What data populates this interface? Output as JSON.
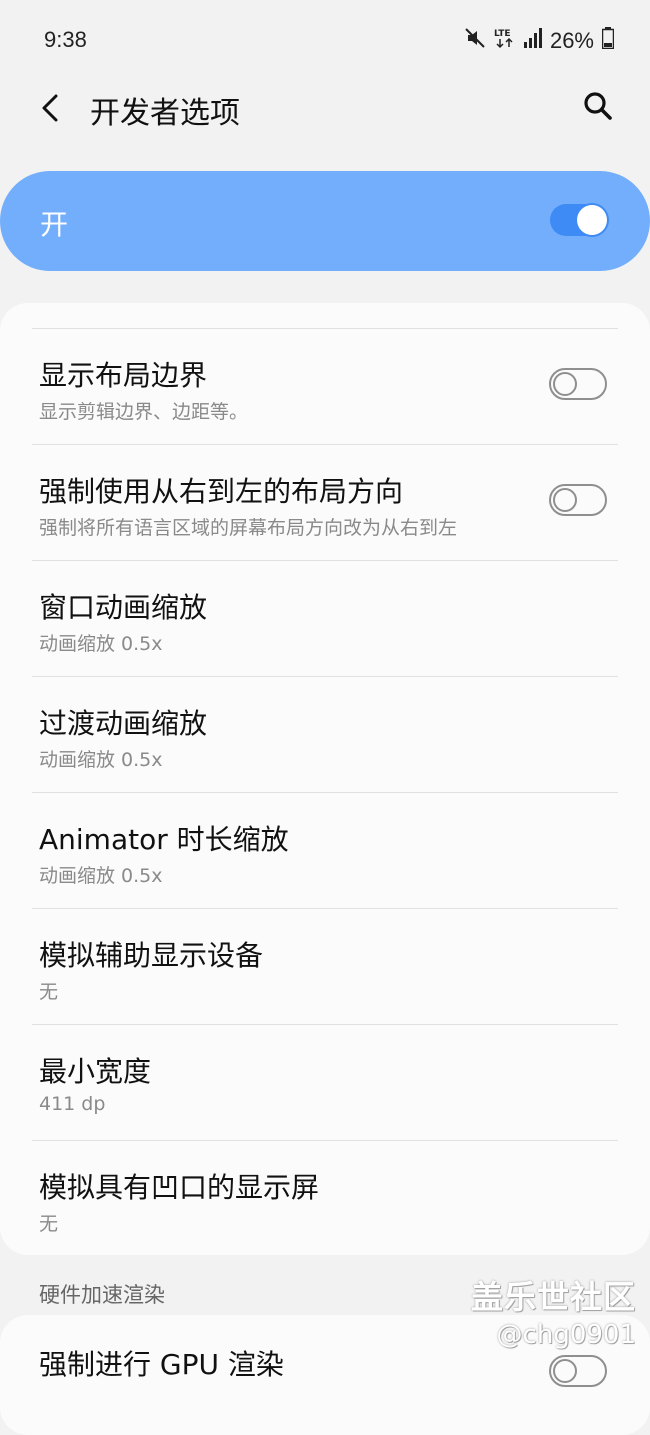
{
  "status_bar": {
    "time": "9:38",
    "network": "LTE",
    "battery": "26%",
    "icons": [
      "mute-icon",
      "lte-icon",
      "signal-icon",
      "battery-icon"
    ]
  },
  "app_bar": {
    "title": "开发者选项",
    "back_icon": "back-arrow-icon",
    "search_icon": "search-icon"
  },
  "master_switch": {
    "label": "开",
    "state": true,
    "accent_color": "#72aefb"
  },
  "settings": [
    {
      "title": "显示布局边界",
      "subtitle": "显示剪辑边界、边距等。",
      "toggle": false
    },
    {
      "title": "强制使用从右到左的布局方向",
      "subtitle": "强制将所有语言区域的屏幕布局方向改为从右到左",
      "toggle": false
    },
    {
      "title": "窗口动画缩放",
      "subtitle": "动画缩放 0.5x"
    },
    {
      "title": "过渡动画缩放",
      "subtitle": "动画缩放 0.5x"
    },
    {
      "title": "Animator 时长缩放",
      "subtitle": "动画缩放 0.5x"
    },
    {
      "title": "模拟辅助显示设备",
      "subtitle": "无"
    },
    {
      "title": "最小宽度",
      "subtitle": "411 dp"
    },
    {
      "title": "模拟具有凹口的显示屏",
      "subtitle": "无"
    }
  ],
  "hardware_section": {
    "header": "硬件加速渲染",
    "items": [
      {
        "title": "强制进行 GPU 渲染",
        "toggle": false
      }
    ]
  },
  "watermark": {
    "line1": "盖乐世社区",
    "line2": "@chg0901"
  }
}
